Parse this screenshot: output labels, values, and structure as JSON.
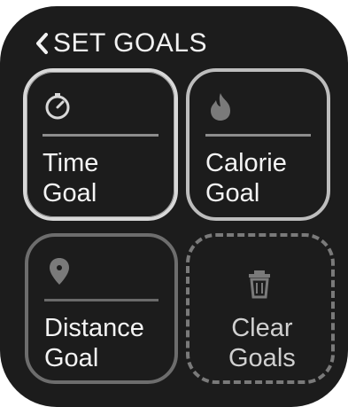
{
  "header": {
    "back_icon": "chevron-left-icon",
    "title": "SET GOALS"
  },
  "tiles": [
    {
      "icon": "stopwatch-icon",
      "line1": "Time",
      "line2": "Goal",
      "state": "selected"
    },
    {
      "icon": "flame-icon",
      "line1": "Calorie",
      "line2": "Goal",
      "state": "normal"
    },
    {
      "icon": "location-pin-icon",
      "line1": "Distance",
      "line2": "Goal",
      "state": "dim"
    },
    {
      "icon": "trash-icon",
      "line1": "Clear",
      "line2": "Goals",
      "state": "dim"
    }
  ],
  "colors": {
    "background": "#1c1c1c",
    "text": "#f2f2f2",
    "tile_border_selected": "#d8d8d8",
    "tile_border": "#bdbdbd",
    "tile_border_dim": "#6d6d6d"
  }
}
